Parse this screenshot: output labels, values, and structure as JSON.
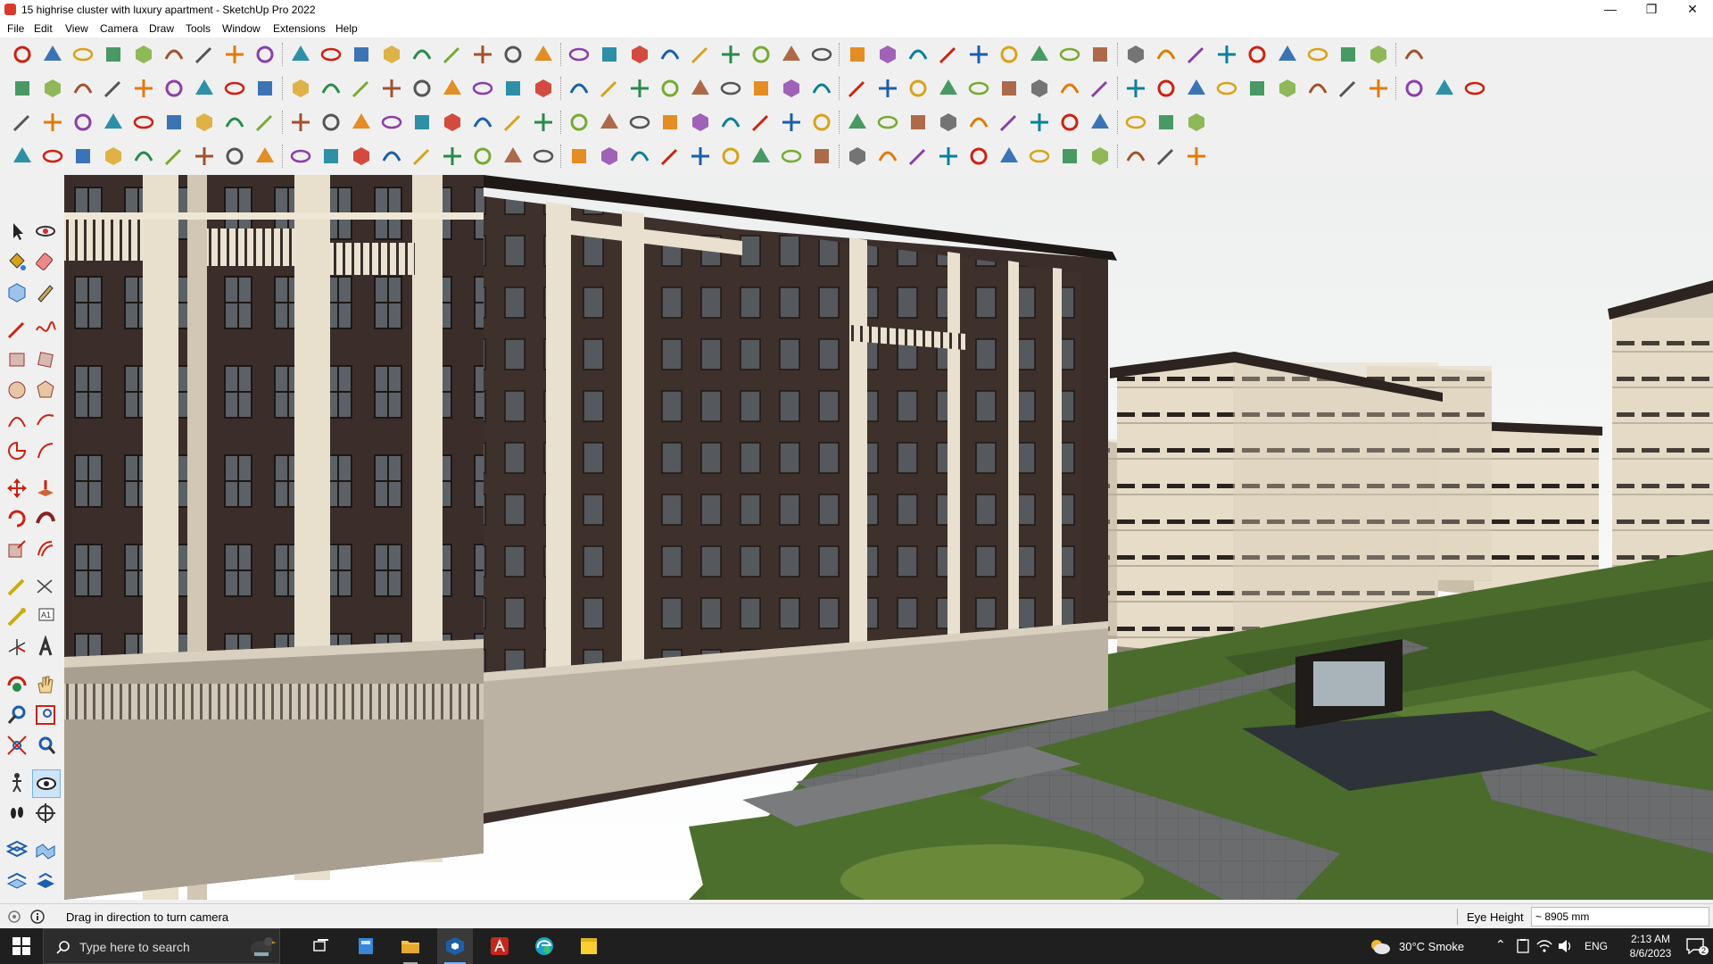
{
  "window": {
    "title": "15 highrise cluster with luxury apartment - SketchUp Pro 2022",
    "minimize": "—",
    "maximize": "❐",
    "close": "✕"
  },
  "menu": [
    "File",
    "Edit",
    "View",
    "Camera",
    "Draw",
    "Tools",
    "Window",
    "Extensions",
    "Help"
  ],
  "status": {
    "hint": "Drag in direction to turn camera",
    "measure_label": "Eye Height",
    "measure_value": "~ 8905 mm"
  },
  "taskbar": {
    "search_placeholder": "Type here to search",
    "weather": "30°C  Smoke",
    "language": "ENG",
    "time": "2:13 AM",
    "date": "8/6/2023",
    "notification_count": "2"
  },
  "colors": {
    "accent": "#0b63ce",
    "building_dark": "#3b2e2a",
    "building_light": "#e9e0cf",
    "lawn": "#4a6b2c",
    "paving": "#6d6d6d"
  }
}
